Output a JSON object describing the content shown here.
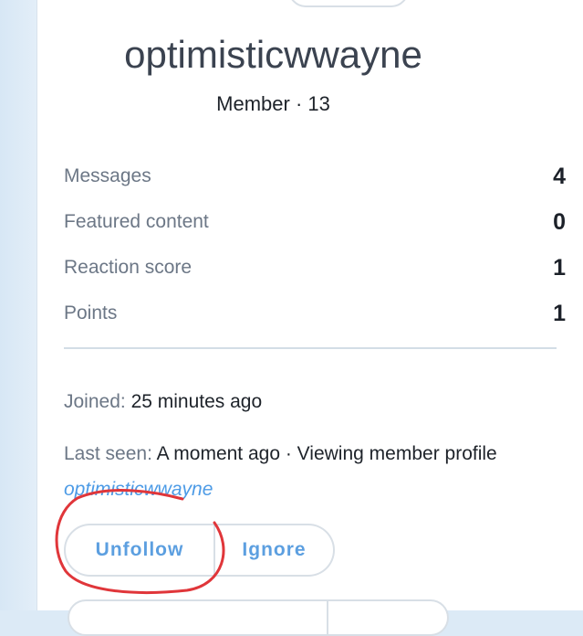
{
  "profile": {
    "username": "optimisticwwayne",
    "title_line": "Member · 13"
  },
  "stats": [
    {
      "label": "Messages",
      "value": "4"
    },
    {
      "label": "Featured content",
      "value": "0"
    },
    {
      "label": "Reaction score",
      "value": "1"
    },
    {
      "label": "Points",
      "value": "1"
    }
  ],
  "info": {
    "joined_label": "Joined:",
    "joined_value": "25 minutes ago",
    "last_seen_label": "Last seen:",
    "last_seen_value": "A moment ago · Viewing member profile",
    "last_seen_link": "optimisticwwayne"
  },
  "actions": {
    "unfollow_label": "Unfollow",
    "ignore_label": "Ignore"
  },
  "colors": {
    "accent": "#5c9fe0",
    "annotation": "#e0363a"
  }
}
